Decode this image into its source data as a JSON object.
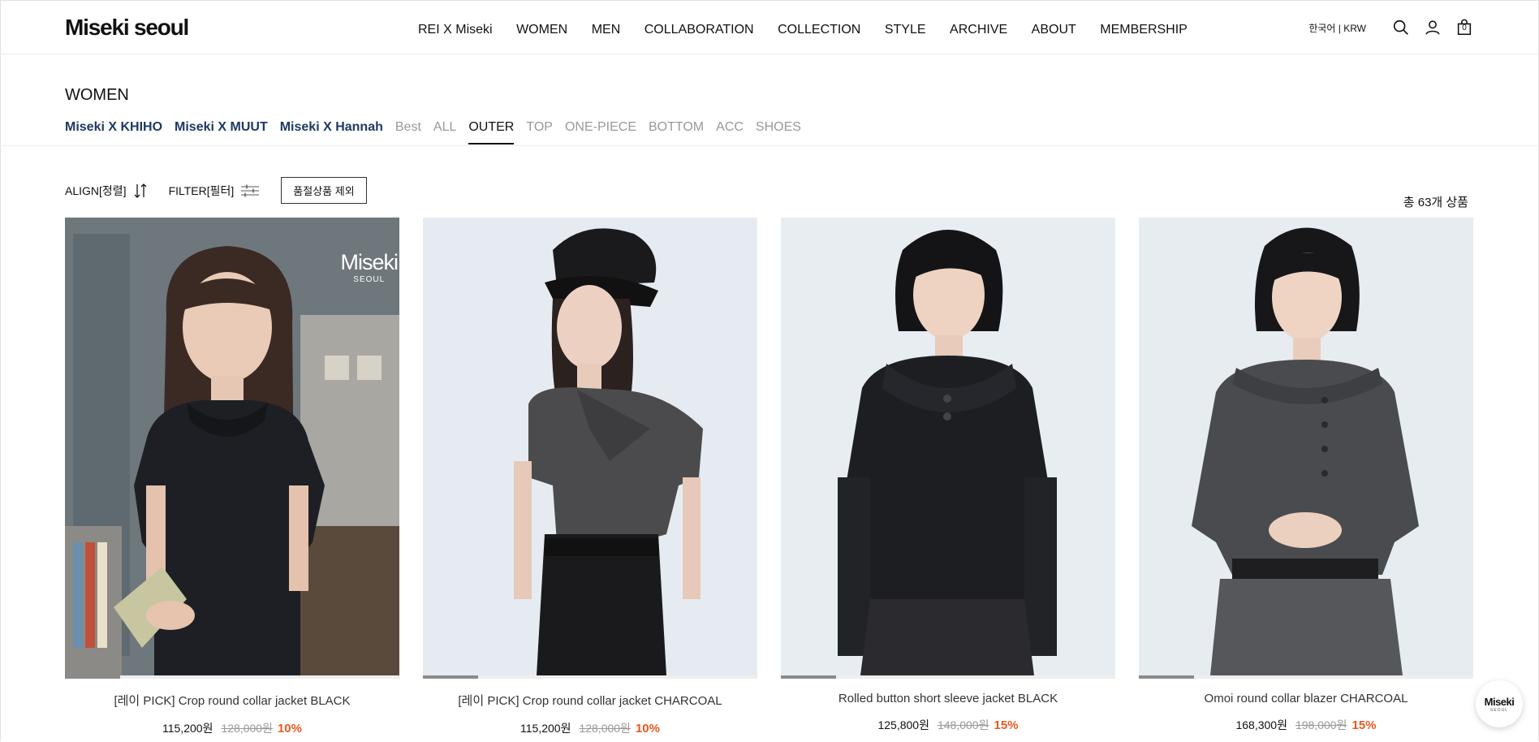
{
  "header": {
    "logo": "Miseki seoul",
    "nav": [
      "REI X Miseki",
      "WOMEN",
      "MEN",
      "COLLABORATION",
      "COLLECTION",
      "STYLE",
      "ARCHIVE",
      "ABOUT",
      "MEMBERSHIP"
    ],
    "lang": "한국어 | KRW",
    "cart_count": "0"
  },
  "category": {
    "title": "WOMEN",
    "tabs": [
      {
        "label": "Miseki X KHIHO",
        "type": "collab"
      },
      {
        "label": "Miseki X MUUT",
        "type": "collab"
      },
      {
        "label": "Miseki X Hannah",
        "type": "collab"
      },
      {
        "label": "Best",
        "type": "normal"
      },
      {
        "label": "ALL",
        "type": "normal"
      },
      {
        "label": "OUTER",
        "type": "active"
      },
      {
        "label": "TOP",
        "type": "normal"
      },
      {
        "label": "ONE-PIECE",
        "type": "normal"
      },
      {
        "label": "BOTTOM",
        "type": "normal"
      },
      {
        "label": "ACC",
        "type": "normal"
      },
      {
        "label": "SHOES",
        "type": "normal"
      }
    ]
  },
  "toolbar": {
    "align_label": "ALIGN[정렬]",
    "filter_label": "FILTER[필터]",
    "exclude_soldout": "품절상품 제외",
    "total_count": "총 63개 상품"
  },
  "products": [
    {
      "name": "[레이 PICK] Crop round collar jacket BLACK",
      "sale_price": "115,200원",
      "original_price": "128,000원",
      "discount": "10%",
      "watermark": "Miseki",
      "watermark_sub": "SEOUL"
    },
    {
      "name": "[레이 PICK] Crop round collar jacket CHARCOAL",
      "sale_price": "115,200원",
      "original_price": "128,000원",
      "discount": "10%"
    },
    {
      "name": "Rolled button short sleeve jacket BLACK",
      "sale_price": "125,800원",
      "original_price": "148,000원",
      "discount": "15%"
    },
    {
      "name": "Omoi round collar blazer CHARCOAL",
      "sale_price": "168,300원",
      "original_price": "198,000원",
      "discount": "15%"
    }
  ],
  "chat_widget": {
    "title": "Miseki",
    "sub": "SEOUL"
  },
  "colors": {
    "accent_discount": "#e8591f",
    "collab_tab": "#1e3a63"
  }
}
